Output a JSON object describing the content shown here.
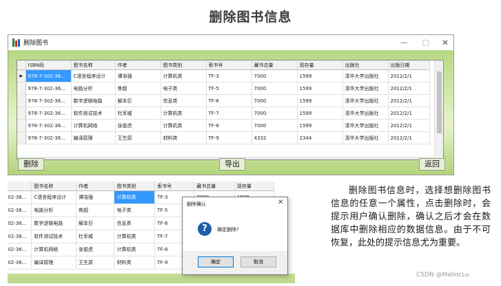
{
  "slide": {
    "title": "删除图书信息"
  },
  "window": {
    "title": "删除图书",
    "minimize": "—",
    "maximize": "□",
    "close": "✕"
  },
  "table": {
    "columns": [
      "ISBN码",
      "图书名称",
      "作者",
      "图书类别",
      "索书号",
      "藏书总量",
      "现存量",
      "出版社",
      "出版日期"
    ],
    "rows": [
      [
        "978-7-302-36...",
        "C语言程序设计",
        "谭浩强",
        "计算机类",
        "TF-3",
        "7000",
        "1599",
        "清华大学出版社",
        "2012/2/1"
      ],
      [
        "978-7-302-36...",
        "电路分析",
        "焦超",
        "电子类",
        "TF-5",
        "7000",
        "1599",
        "清华大学出版社",
        "2012/2/1"
      ],
      [
        "978-7-302-36...",
        "数字逻辑电路",
        "解本巨",
        "信息类",
        "TF-6",
        "7000",
        "1599",
        "清华大学出版社",
        "2012/2/1"
      ],
      [
        "978-7-302-36...",
        "软件测试技术",
        "杜军威",
        "计算机类",
        "TF-7",
        "7000",
        "1599",
        "清华大学出版社",
        "2012/2/1"
      ],
      [
        "978-7-302-36...",
        "计算机网络",
        "张俊虎",
        "计算机类",
        "TF-8",
        "7000",
        "1599",
        "清华大学出版社",
        "2012/2/1"
      ],
      [
        "978-7-302-36...",
        "编译原理",
        "王生原",
        "材料类",
        "TF-9",
        "4332",
        "2344",
        "清华大学出版社",
        "2012/2/1"
      ]
    ],
    "current_row_marker": "▶"
  },
  "buttons": {
    "delete": "删除",
    "export": "导出",
    "back": "返回"
  },
  "dialog": {
    "title": "删除确认",
    "close": "✕",
    "icon": "?",
    "message": "确定删除?",
    "ok": "确定",
    "cancel": "取消"
  },
  "description": "删除图书信息时，选择想删除图书信息的任意一个属性，点击删除时，会提示用户确认删除，确认之后才会在数据库中删除相应的数据信息。由于不可恢复，此处的提示信息尤为重要。",
  "watermark": "CSDN @MallocLu",
  "colors": {
    "selection": "#3399ff",
    "window_bg": "#c4de95",
    "dialog_icon": "#1c5fa8"
  }
}
